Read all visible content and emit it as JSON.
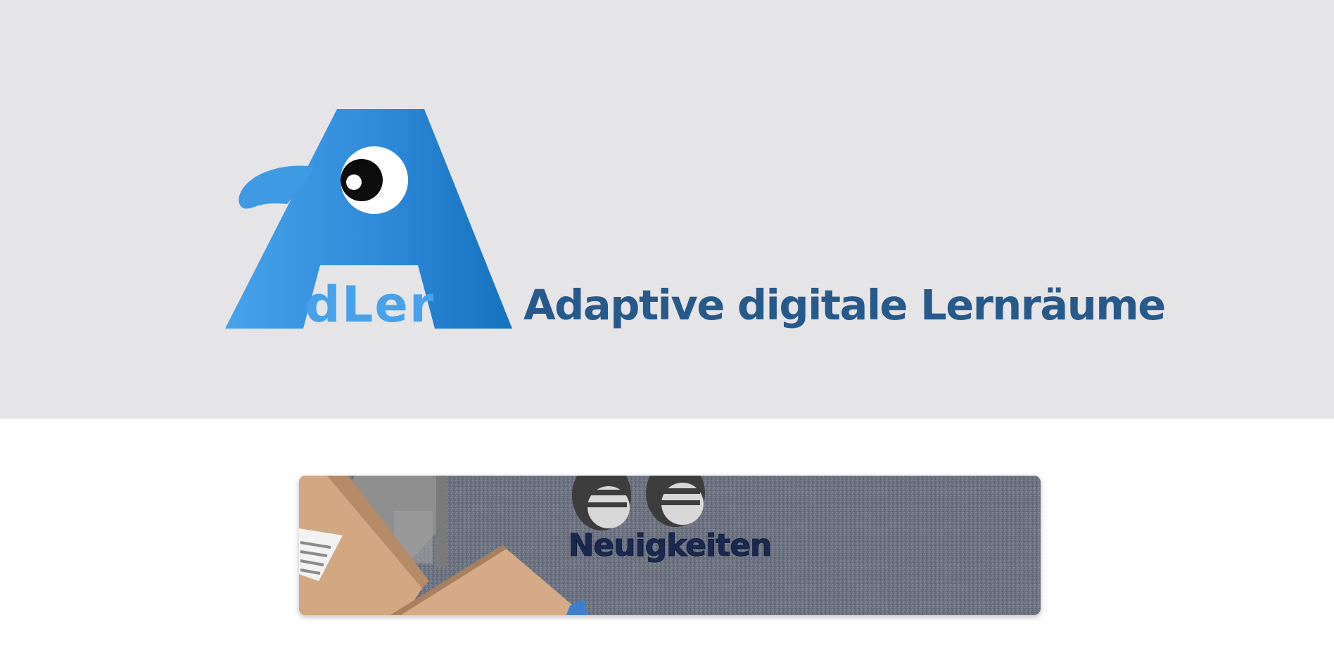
{
  "header": {
    "logo_text": "dLer",
    "tagline": "Adaptive digitale Lernräume",
    "colors": {
      "background": "#e5e5e7",
      "logo_blue_light": "#47a2ea",
      "logo_blue_dark": "#1572bf",
      "tagline": "#27598a"
    }
  },
  "news": {
    "title": "Neuigkeiten",
    "colors": {
      "title": "#1a2a4f",
      "carpet": "#6c7280",
      "table": "#d4ab86"
    }
  }
}
